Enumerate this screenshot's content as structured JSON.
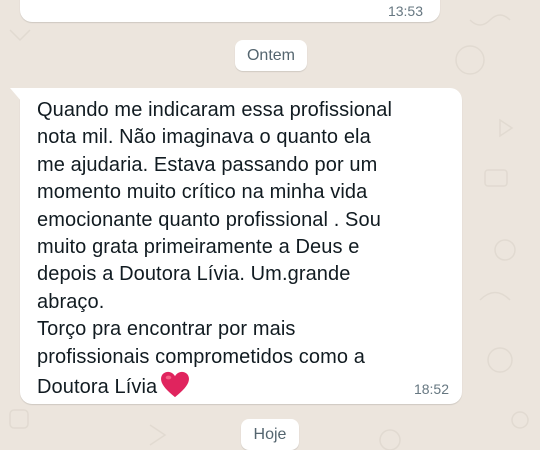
{
  "previous_message": {
    "time": "13:53"
  },
  "date_separators": {
    "yesterday": "Ontem",
    "today": "Hoje"
  },
  "message": {
    "lines": [
      "Quando me indicaram essa profissional",
      "nota mil. Não imaginava o quanto ela",
      "me ajudaria. Estava passando por um",
      "momento muito crítico na minha vida",
      "emocionante quanto profissional . Sou",
      "muito grata primeiramente a Deus e",
      "depois a Doutora Lívia. Um.grande",
      "abraço.",
      "Torço pra encontrar por mais",
      "profissionais comprometidos como a",
      "Doutora Lívia"
    ],
    "emoji": "heart-icon",
    "time": "18:52"
  },
  "colors": {
    "wallpaper": "#ece5dd",
    "bubble": "#ffffff",
    "text": "#111b21",
    "timestamp": "#667781",
    "heart": "#e0245e"
  }
}
